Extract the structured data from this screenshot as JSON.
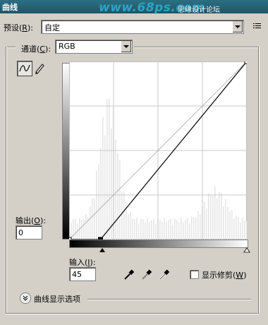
{
  "window": {
    "title": "曲线"
  },
  "watermark": {
    "site": "www.68ps.com",
    "tag": "思缘设计论坛"
  },
  "preset": {
    "label": "预设(",
    "key": "R",
    "suffix": "):",
    "value": "自定"
  },
  "channel": {
    "label": "通道(",
    "key": "C",
    "suffix": "):",
    "value": "RGB"
  },
  "output": {
    "label": "输出(",
    "key": "O",
    "suffix": "):",
    "value": "0"
  },
  "input": {
    "label": "输入(",
    "key": "I",
    "suffix": "):",
    "value": "45"
  },
  "clipping": {
    "label": "显示修剪(",
    "key": "W",
    "suffix": ")",
    "checked": false
  },
  "curve_options": {
    "label": "曲线显示选项"
  },
  "curve": {
    "input_range": [
      0,
      255
    ],
    "output_range": [
      0,
      255
    ],
    "points": [
      [
        0,
        0
      ],
      [
        45,
        0
      ],
      [
        255,
        255
      ]
    ]
  },
  "icons": {
    "curve_tool": "curve-pencil-icon",
    "pencil_tool": "pencil-icon",
    "preset_menu": "menu-list-icon",
    "black_point": "black-eyedropper-icon",
    "gray_point": "gray-eyedropper-icon",
    "white_point": "white-eyedropper-icon",
    "expand": "chevron-down-icon"
  }
}
